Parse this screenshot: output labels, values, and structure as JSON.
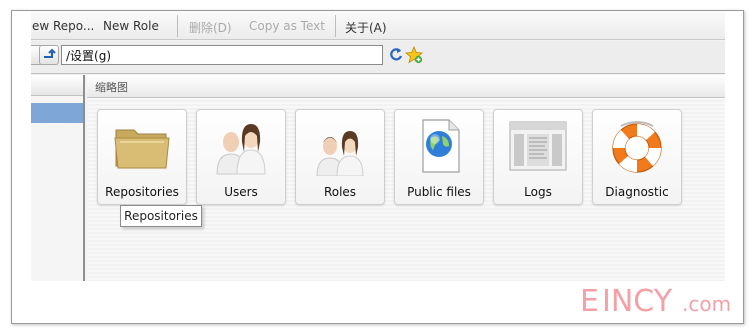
{
  "menu": {
    "items": [
      "New Repo...",
      "New Role",
      "删除(D)",
      "Copy as Text",
      "关于(A)"
    ]
  },
  "address_bar": {
    "path": "/设置(g)"
  },
  "content": {
    "header": "缩略图"
  },
  "tiles": [
    {
      "label": "Repositories",
      "icon": "folder-icon"
    },
    {
      "label": "Users",
      "icon": "users-icon"
    },
    {
      "label": "Roles",
      "icon": "roles-icon"
    },
    {
      "label": "Public files",
      "icon": "public-file-icon"
    },
    {
      "label": "Logs",
      "icon": "logs-icon"
    },
    {
      "label": "Diagnostic",
      "icon": "lifebuoy-icon"
    }
  ],
  "tooltip": {
    "text": "Repositories"
  },
  "watermark": {
    "text": "EINCY.com"
  }
}
